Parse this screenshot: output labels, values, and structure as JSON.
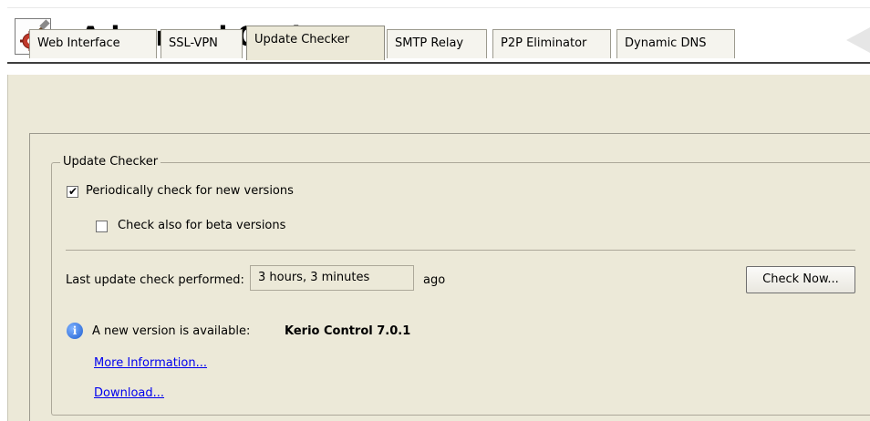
{
  "header": {
    "title": "Advanced Options",
    "icon": "gear-hammer-icon"
  },
  "tabs": [
    {
      "label": "Web Interface",
      "active": false
    },
    {
      "label": "SSL-VPN",
      "active": false
    },
    {
      "label": "Update Checker",
      "active": true
    },
    {
      "label": "SMTP Relay",
      "active": false
    },
    {
      "label": "P2P Eliminator",
      "active": false
    },
    {
      "label": "Dynamic DNS",
      "active": false
    }
  ],
  "update_checker": {
    "group_title": "Update Checker",
    "periodic_check": {
      "label": "Periodically check for new versions",
      "checked": true
    },
    "beta_check": {
      "label": "Check also for beta versions",
      "checked": false
    },
    "last_check_label": "Last update check performed:",
    "last_check_value": "3 hours, 3 minutes",
    "last_check_suffix": "ago",
    "check_now_button": "Check Now...",
    "new_version_label": "A new version is available:",
    "new_version_value": "Kerio Control 7.0.1",
    "more_info_link": "More Information...",
    "download_link": "Download..."
  },
  "colors": {
    "panel_bg": "#ece9d8",
    "link": "#0000ee",
    "info_icon": "#1f5fd0"
  }
}
